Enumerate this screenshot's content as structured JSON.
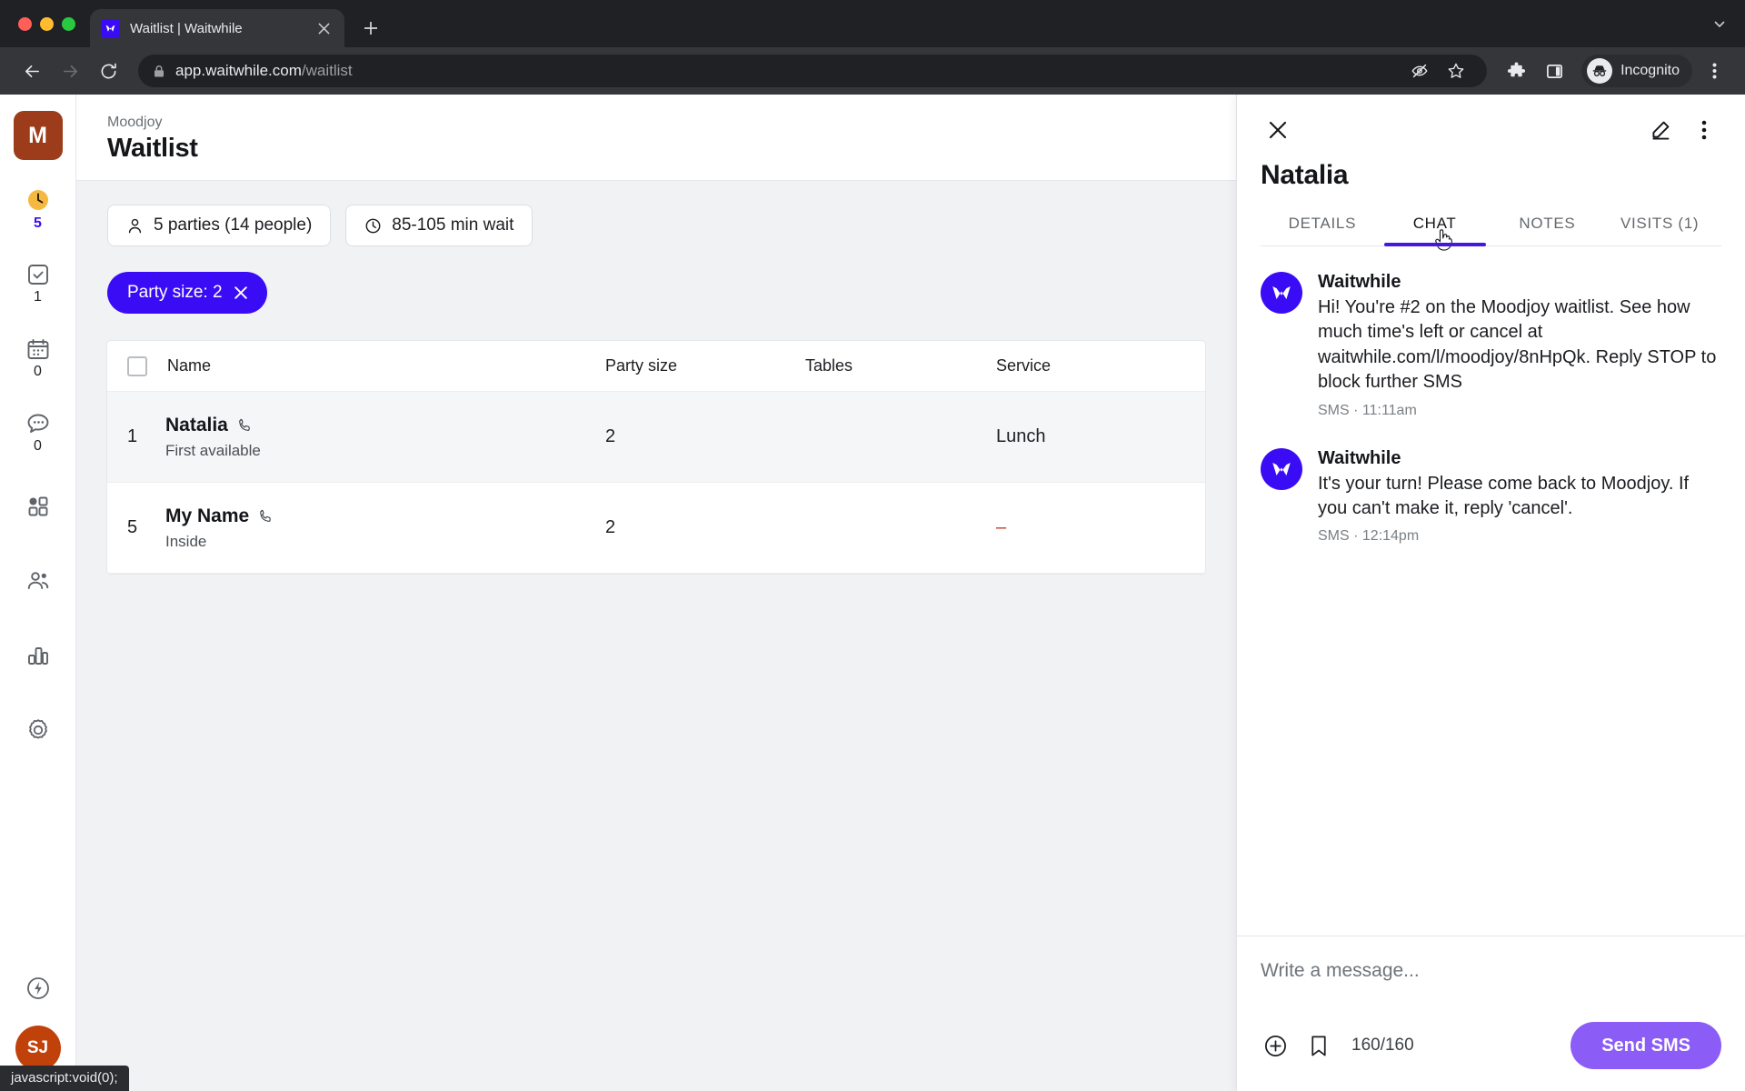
{
  "browser": {
    "tab": {
      "title": "Waitlist | Waitwhile",
      "favicon_icon": "waitwhile-logo-icon",
      "close_icon": "close-icon"
    },
    "new_tab_label": "+",
    "tab_list_chevron": "⌄",
    "nav": {
      "back_icon": "back-arrow-icon",
      "forward_icon": "forward-arrow-icon",
      "reload_icon": "reload-icon"
    },
    "omnibox": {
      "lock_icon": "lock-icon",
      "host": "app.waitwhile.com",
      "path": "/waitlist"
    },
    "toolbar": {
      "eye_off_icon": "eye-off-icon",
      "bookmark_star_icon": "star-icon",
      "extensions_icon": "puzzle-icon",
      "side_panel_icon": "side-panel-icon",
      "profile_label": "Incognito",
      "menu_icon": "three-dot-menu-icon"
    },
    "status_text": "javascript:void(0);"
  },
  "rail": {
    "org_initial": "M",
    "items": [
      {
        "name": "waitlist",
        "icon": "clock-icon",
        "badge": "5",
        "active": true
      },
      {
        "name": "served",
        "icon": "check-square-icon",
        "badge": "1",
        "active": false
      },
      {
        "name": "bookings",
        "icon": "calendar-icon",
        "badge": "0",
        "active": false
      },
      {
        "name": "messages",
        "icon": "chat-bubble-icon",
        "badge": "0",
        "active": false
      },
      {
        "name": "apps",
        "icon": "grid-icon",
        "badge": "",
        "active": false
      },
      {
        "name": "customers",
        "icon": "people-icon",
        "badge": "",
        "active": false
      },
      {
        "name": "analytics",
        "icon": "bar-chart-icon",
        "badge": "",
        "active": false
      },
      {
        "name": "settings",
        "icon": "gear-icon",
        "badge": "",
        "active": false
      }
    ],
    "bottom": {
      "power_icon": "lightning-bolt-icon",
      "avatar_initials": "SJ"
    }
  },
  "header": {
    "breadcrumb": "Moodjoy",
    "title": "Waitlist"
  },
  "stats": [
    {
      "icon": "person-icon",
      "label": "5 parties (14 people)"
    },
    {
      "icon": "clock-icon",
      "label": "85-105 min wait"
    }
  ],
  "filter": {
    "label": "Party size: 2",
    "remove_icon": "close-icon"
  },
  "table": {
    "columns": [
      "Name",
      "Party size",
      "Tables",
      "Service"
    ],
    "rows": [
      {
        "position": "1",
        "name": "Natalia",
        "contact_icon": "phone-icon",
        "sub": "First available",
        "party_size": "2",
        "tables": "",
        "service": "Lunch",
        "service_empty": false,
        "selected": true
      },
      {
        "position": "5",
        "name": "My Name",
        "contact_icon": "phone-icon",
        "sub": "Inside",
        "party_size": "2",
        "tables": "",
        "service": "–",
        "service_empty": true,
        "selected": false
      }
    ]
  },
  "panel": {
    "close_icon": "close-icon",
    "edit_icon": "pencil-icon",
    "more_icon": "three-dot-menu-icon",
    "customer_name": "Natalia",
    "tabs": [
      {
        "label": "DETAILS",
        "active": false
      },
      {
        "label": "CHAT",
        "active": true
      },
      {
        "label": "NOTES",
        "active": false
      },
      {
        "label": "VISITS (1)",
        "active": false
      }
    ],
    "messages": [
      {
        "sender": "Waitwhile",
        "avatar_icon": "waitwhile-logo-icon",
        "text": "Hi! You're #2 on the Moodjoy waitlist. See how much time's left or cancel at waitwhile.com/l/moodjoy/8nHpQk. Reply STOP to block further SMS",
        "meta": "SMS · 11:11am"
      },
      {
        "sender": "Waitwhile",
        "avatar_icon": "waitwhile-logo-icon",
        "text": "It's your turn! Please come back to Moodjoy. If you can't make it, reply 'cancel'.",
        "meta": "SMS · 12:14pm"
      }
    ],
    "composer": {
      "placeholder": "Write a message...",
      "attach_icon": "plus-circle-icon",
      "template_icon": "bookmark-icon",
      "counter": "160/160",
      "send_label": "Send SMS"
    }
  },
  "colors": {
    "brand_blue": "#3a0cf5",
    "tab_underline": "#4318e0",
    "send_button": "#8b5cf6",
    "org_logo": "#9c3c1b",
    "user_avatar": "#c1410a",
    "clock_badge": "#f5b942",
    "dash_red": "#c0392b"
  }
}
